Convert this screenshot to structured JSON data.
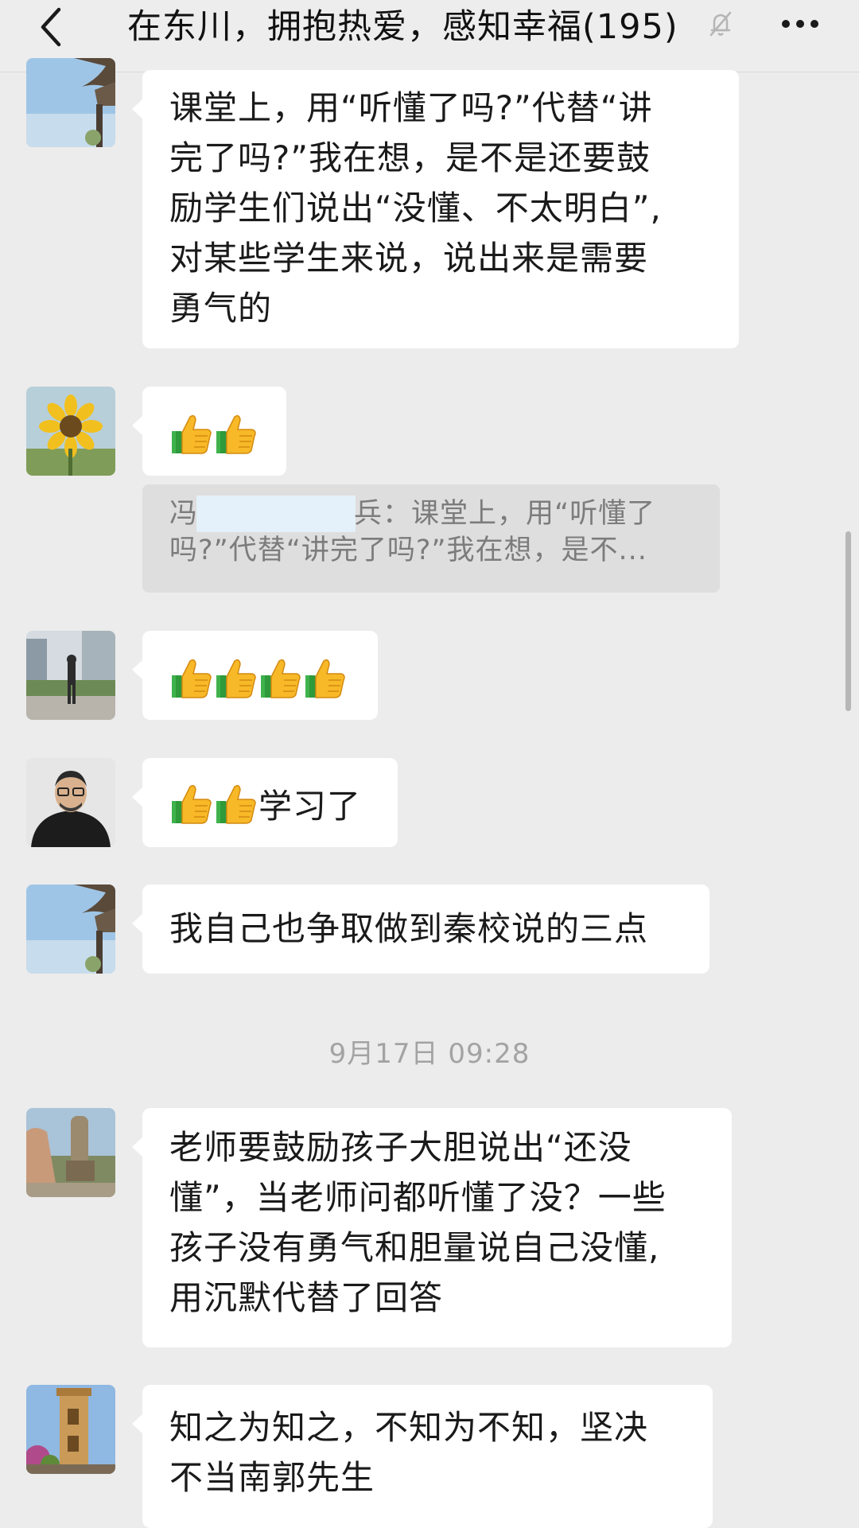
{
  "header": {
    "title": "在东川，拥抱热爱，感知幸福(195)",
    "back_icon": "chevron-left-icon",
    "mute_icon": "bell-muted-icon",
    "more_icon": "more-dots-icon"
  },
  "messages": [
    {
      "avatar": "avatar-pavilion",
      "lines": [
        "课堂上，用“听懂了吗?”代替“讲",
        "完了吗?”我在想，是不是还要鼓",
        "励学生们说出“没懂、不太明白”,",
        "对某些学生来说，说出来是需要",
        "勇气的"
      ]
    },
    {
      "avatar": "avatar-sunflower",
      "emoji": "thumbs-up-icon",
      "emoji_count": 2,
      "quote": {
        "prefix": "冯",
        "suffix": "兵：课堂上，用“听懂了",
        "line2": "吗?”代替“讲完了吗?”我在想，是不..."
      }
    },
    {
      "avatar": "avatar-person-walk",
      "emoji": "thumbs-up-icon",
      "emoji_count": 4
    },
    {
      "avatar": "avatar-man-glasses",
      "emoji": "thumbs-up-icon",
      "emoji_count": 2,
      "text": "学习了"
    },
    {
      "avatar": "avatar-pavilion",
      "text": "我自己也争取做到秦校说的三点"
    },
    {
      "avatar": "avatar-hand-statue",
      "lines": [
        "老师要鼓励孩子大胆说出“还没",
        "懂”，当老师问都听懂了没？一些",
        "孩子没有勇气和胆量说自己没懂,",
        "用沉默代替了回答"
      ]
    },
    {
      "avatar": "avatar-tower",
      "lines": [
        "知之为知之，不知为不知，坚决",
        "不当南郭先生"
      ]
    }
  ],
  "timestamp": "9月17日 09:28",
  "colors": {
    "background": "#ececec",
    "bubble": "#ffffff",
    "quote_bg": "#dedede"
  }
}
